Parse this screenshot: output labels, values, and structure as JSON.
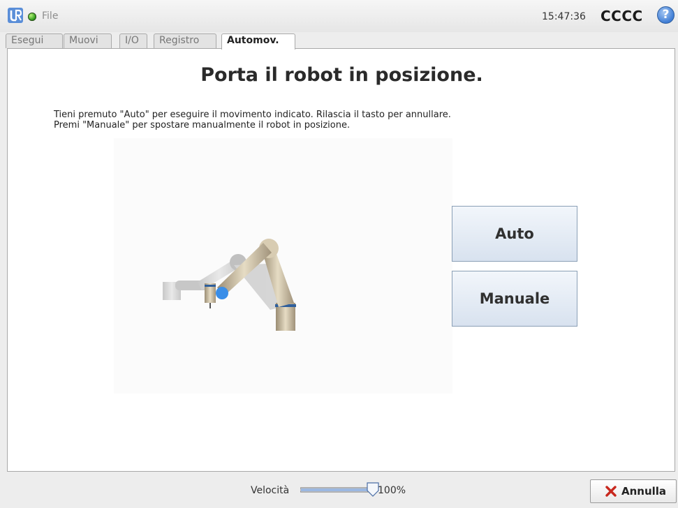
{
  "header": {
    "file_menu": "File",
    "clock": "15:47:36",
    "robot_name": "CCCC",
    "help_label": "?"
  },
  "tabs": [
    {
      "label": "Esegui",
      "active": false
    },
    {
      "label": "Muovi",
      "active": false
    },
    {
      "label": "I/O",
      "active": false
    },
    {
      "label": "Registro",
      "active": false
    },
    {
      "label": "Automov.",
      "active": true
    }
  ],
  "main": {
    "title": "Porta il robot in posizione.",
    "instructions": [
      "Tieni premuto \"Auto\" per eseguire il movimento indicato. Rilascia il tasto per annullare.",
      "Premi \"Manuale\" per spostare manualmente il robot in posizione."
    ],
    "auto_label": "Auto",
    "manual_label": "Manuale"
  },
  "footer": {
    "speed_label": "Velocità",
    "speed_value": "100%",
    "speed_fraction": 1.0,
    "cancel_label": "Annulla"
  },
  "colors": {
    "status_ok": "#2f9d1b",
    "button_border": "#8a9fb6",
    "cancel_red": "#c8281e"
  },
  "icons": {
    "logo": "ur-logo-icon",
    "status": "status-led-icon",
    "help": "help-icon",
    "cancel": "close-x-icon",
    "slider_thumb": "slider-thumb-icon"
  }
}
